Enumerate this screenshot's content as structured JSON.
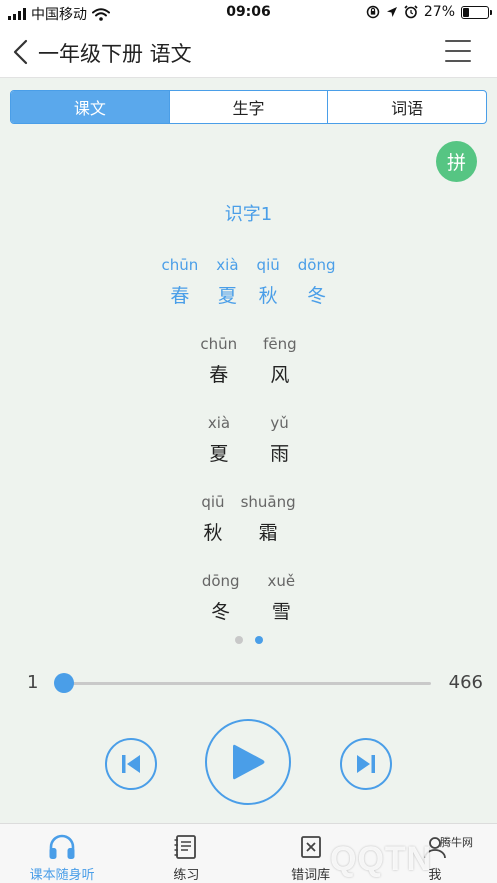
{
  "status_bar": {
    "carrier": "中国移动",
    "time": "09:06",
    "battery_percent": "27%",
    "battery_level": 0.27
  },
  "nav": {
    "title": "一年级下册 语文"
  },
  "tabs": [
    {
      "label": "课文",
      "active": true
    },
    {
      "label": "生字",
      "active": false
    },
    {
      "label": "词语",
      "active": false
    }
  ],
  "pinyin_toggle_label": "拼",
  "lesson": {
    "title": "识字1",
    "rows": [
      {
        "highlight": true,
        "cells": [
          {
            "py": "chūn",
            "hz": "春"
          },
          {
            "py": "xià",
            "hz": "夏"
          },
          {
            "py": "qiū",
            "hz": "秋"
          },
          {
            "py": "dōng",
            "hz": "冬"
          }
        ]
      },
      {
        "highlight": false,
        "cells": [
          {
            "py": "chūn",
            "hz": "春"
          },
          {
            "py": "fēng",
            "hz": "风"
          }
        ]
      },
      {
        "highlight": false,
        "cells": [
          {
            "py": "xià",
            "hz": "夏"
          },
          {
            "py": "yǔ",
            "hz": "雨"
          }
        ]
      },
      {
        "highlight": false,
        "cells": [
          {
            "py": "qiū",
            "hz": "秋"
          },
          {
            "py": "shuāng",
            "hz": "霜"
          }
        ]
      },
      {
        "highlight": false,
        "cells": [
          {
            "py": "dōng",
            "hz": "冬"
          },
          {
            "py": "xuě",
            "hz": "雪"
          }
        ]
      }
    ]
  },
  "pager": {
    "count": 2,
    "active_index": 1
  },
  "progress": {
    "start_label": "1",
    "end_label": "466",
    "value": 1,
    "max": 466
  },
  "bottom_tabs": [
    {
      "label": "课本随身听",
      "icon": "headphones-icon",
      "active": true
    },
    {
      "label": "练习",
      "icon": "notebook-icon",
      "active": false
    },
    {
      "label": "错词库",
      "icon": "error-book-icon",
      "active": false
    },
    {
      "label": "我",
      "icon": "user-icon",
      "active": false
    }
  ],
  "watermark": {
    "text": "QQTN",
    "sub": "腾牛网"
  },
  "colors": {
    "accent": "#4a9ee8",
    "pinyin_button": "#56c583",
    "background": "#eef3ee"
  }
}
